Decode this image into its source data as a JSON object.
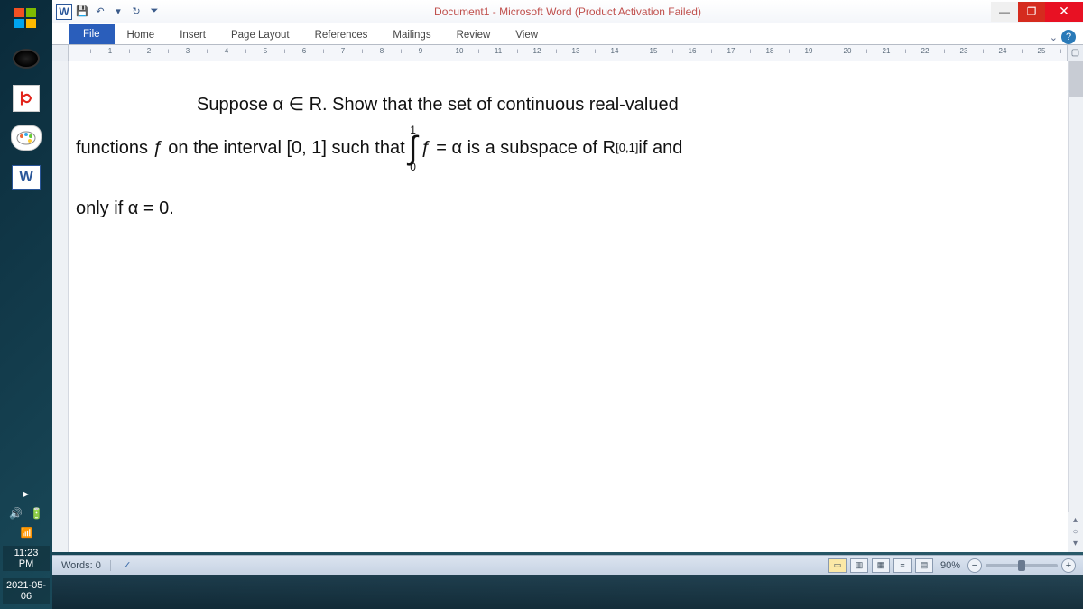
{
  "window": {
    "title": "Document1 - Microsoft Word (Product Activation Failed)",
    "qat": {
      "undo": "↶",
      "redo_dd": "▾",
      "refresh": "↻",
      "more": "⏷"
    }
  },
  "ribbon": {
    "tabs": [
      "File",
      "Home",
      "Insert",
      "Page Layout",
      "References",
      "Mailings",
      "Review",
      "View"
    ]
  },
  "document": {
    "line1": "Suppose α ∈ R.  Show that the set of continuous real-valued",
    "line2_a": "functions ƒ on the interval [0, 1] such that ",
    "integral_upper": "1",
    "integral_lower": "0",
    "integral_sign": "∫",
    "line2_b": " ƒ = α is a subspace of R",
    "line2_sup": "[0,1]",
    "line2_c": " if and",
    "line3": "only if α = 0."
  },
  "statusbar": {
    "words": "Words: 0",
    "zoom": "90%",
    "zoom_minus": "−",
    "zoom_plus": "+"
  },
  "taskbar": {
    "time": "11:23 PM",
    "date": "2021-05-06",
    "word_letter": "W",
    "signal": "📶"
  },
  "winbtns": {
    "min": "—",
    "max": "❐",
    "close": "✕"
  },
  "help": {
    "chev": "⌄",
    "q": "?"
  }
}
